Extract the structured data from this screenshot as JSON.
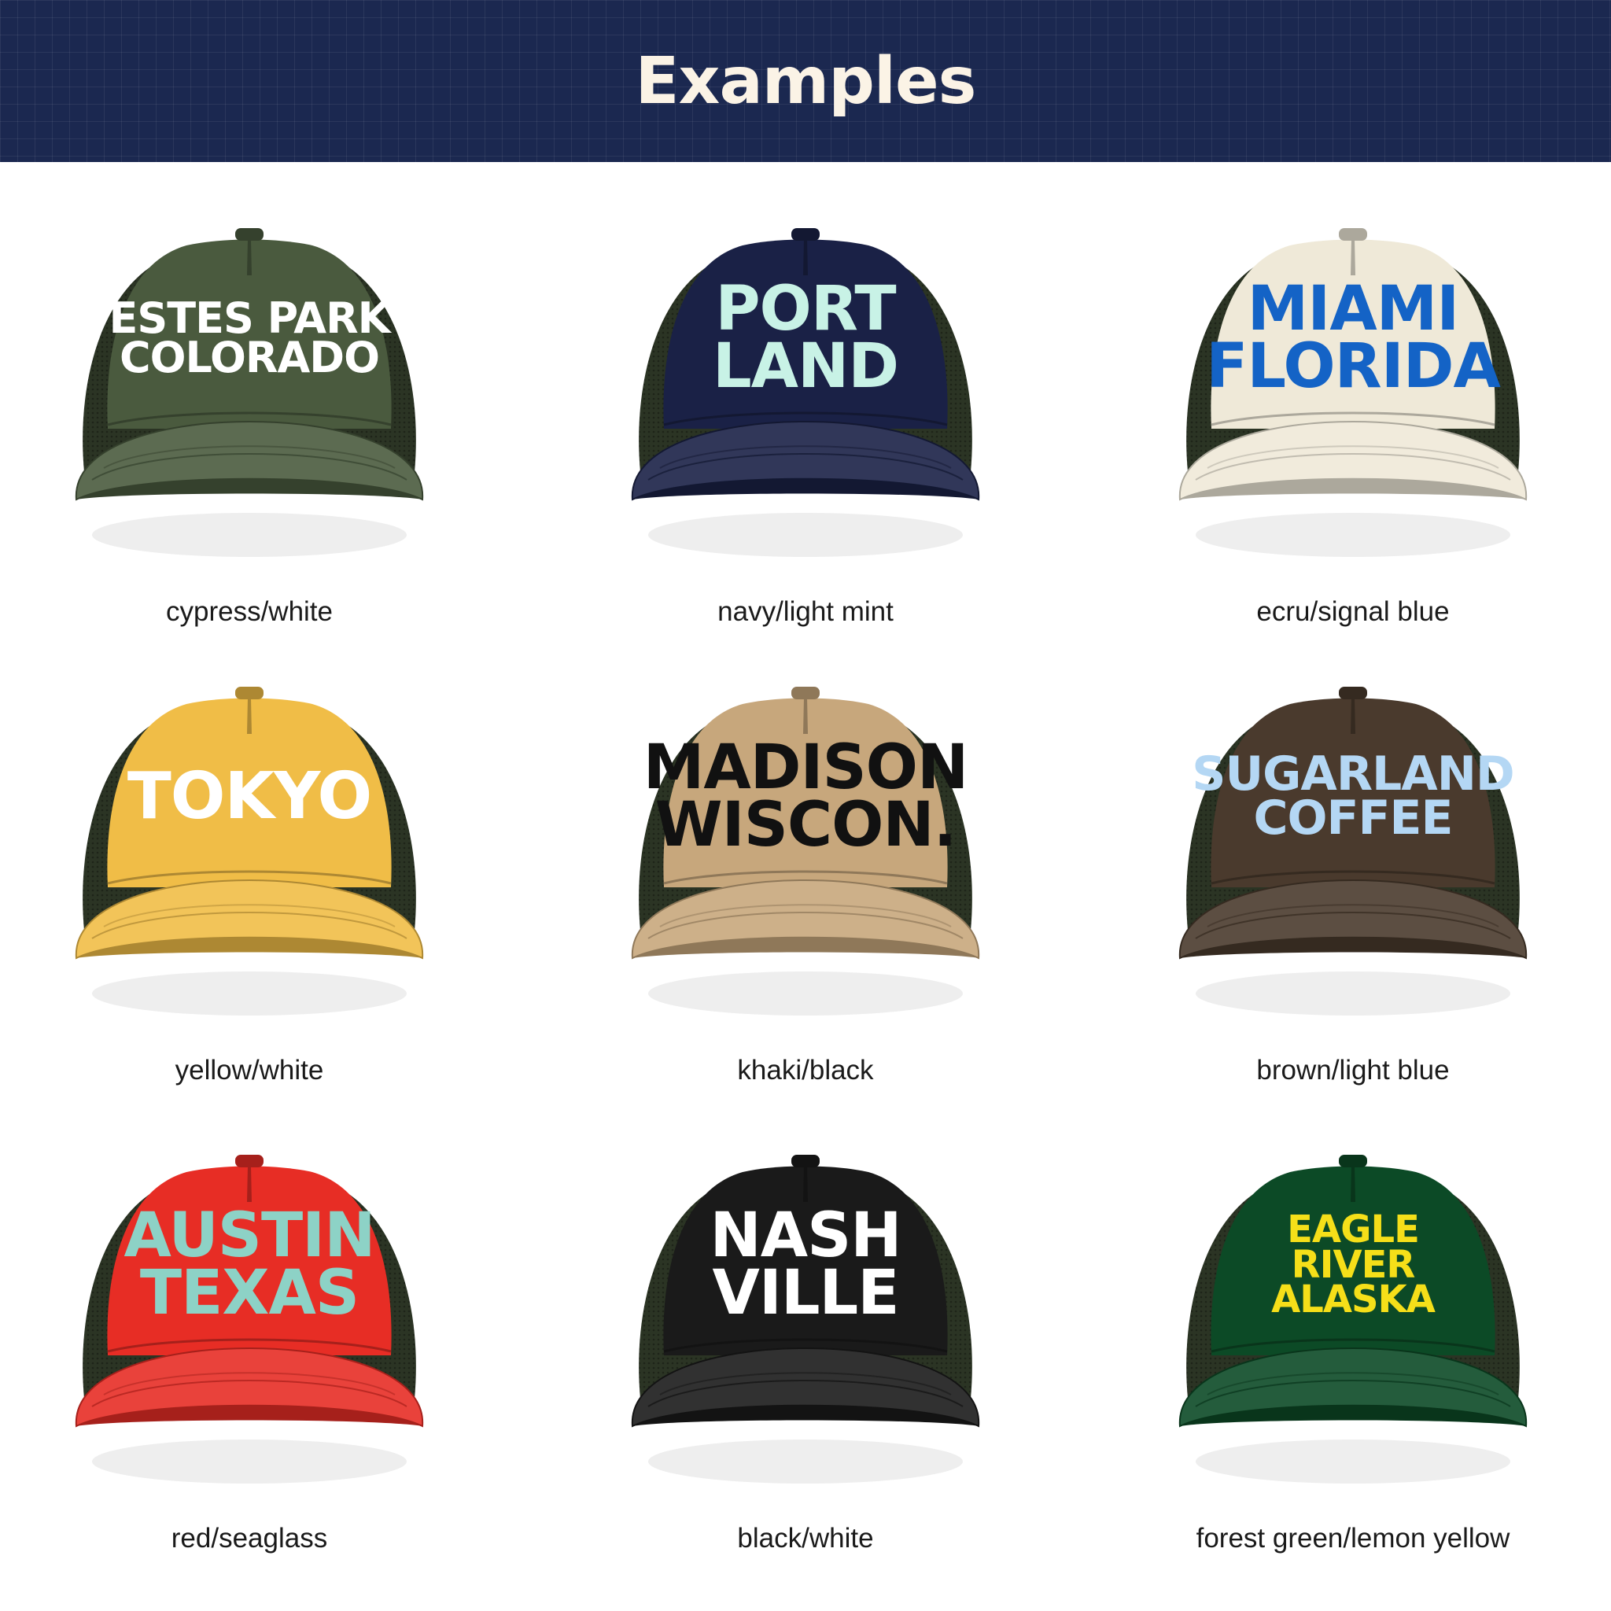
{
  "header": {
    "title": "Examples",
    "background": "#1b2850"
  },
  "hats": [
    {
      "print": [
        "ESTES PARK",
        "COLORADO"
      ],
      "caption": "cypress/white",
      "hat_color": "#4a5a3e",
      "print_color": "#ffffff"
    },
    {
      "print": [
        "PORT",
        "LAND"
      ],
      "caption": "navy/light mint",
      "hat_color": "#1a2146",
      "print_color": "#c8f2e6"
    },
    {
      "print": [
        "MIAMI",
        "FLORIDA"
      ],
      "caption": "ecru/signal blue",
      "hat_color": "#efe9d8",
      "print_color": "#1463c6"
    },
    {
      "print": [
        "TOKYO"
      ],
      "caption": "yellow/white",
      "hat_color": "#f0bd47",
      "print_color": "#ffffff"
    },
    {
      "print": [
        "MADISON",
        "WISCON."
      ],
      "caption": "khaki/black",
      "hat_color": "#c7a77c",
      "print_color": "#111111"
    },
    {
      "print": [
        "SUGARLAND",
        "COFFEE"
      ],
      "caption": "brown/light blue",
      "hat_color": "#4a3a2d",
      "print_color": "#b4d7f4"
    },
    {
      "print": [
        "AUSTIN",
        "TEXAS"
      ],
      "caption": "red/seaglass",
      "hat_color": "#e72d25",
      "print_color": "#8dd2c6"
    },
    {
      "print": [
        "NASH",
        "VILLE"
      ],
      "caption": "black/white",
      "hat_color": "#1a1a1a",
      "print_color": "#ffffff"
    },
    {
      "print": [
        "EAGLE",
        "RIVER",
        "ALASKA"
      ],
      "caption": "forest green/lemon yellow",
      "hat_color": "#0c4a26",
      "print_color": "#f5df19"
    }
  ]
}
